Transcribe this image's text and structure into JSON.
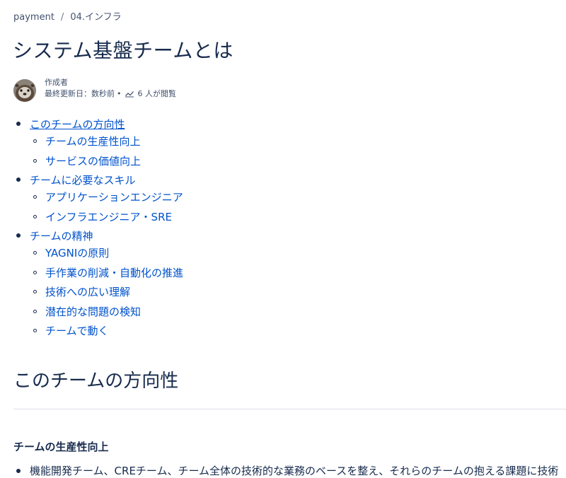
{
  "breadcrumb": {
    "items": [
      "payment",
      "04.インフラ"
    ],
    "separator": "/"
  },
  "page": {
    "title": "システム基盤チームとは"
  },
  "byline": {
    "author_label": "作成者",
    "updated": "最終更新日：数秒前",
    "dot": "•",
    "views": "6 人が閲覧"
  },
  "toc": [
    {
      "label": "このチームの方向性",
      "children": [
        "チームの生産性向上",
        "サービスの価値向上"
      ]
    },
    {
      "label": "チームに必要なスキル",
      "children": [
        "アプリケーションエンジニア",
        "インフラエンジニア・SRE"
      ]
    },
    {
      "label": "チームの精神",
      "children": [
        "YAGNIの原則",
        "手作業の削減・自動化の推進",
        "技術への広い理解",
        "潜在的な問題の検知",
        "チームで動く"
      ]
    }
  ],
  "content": {
    "section_heading": "このチームの方向性",
    "sub_heading": "チームの生産性向上",
    "first_item": "機能開発チーム、CREチーム、チーム全体の技術的な業務のベースを整え、それらのチームの抱える課題に技術"
  },
  "colors": {
    "link": "#0052cc",
    "text": "#172b4d",
    "muted": "#42526e",
    "divider": "#dfe1e6"
  }
}
